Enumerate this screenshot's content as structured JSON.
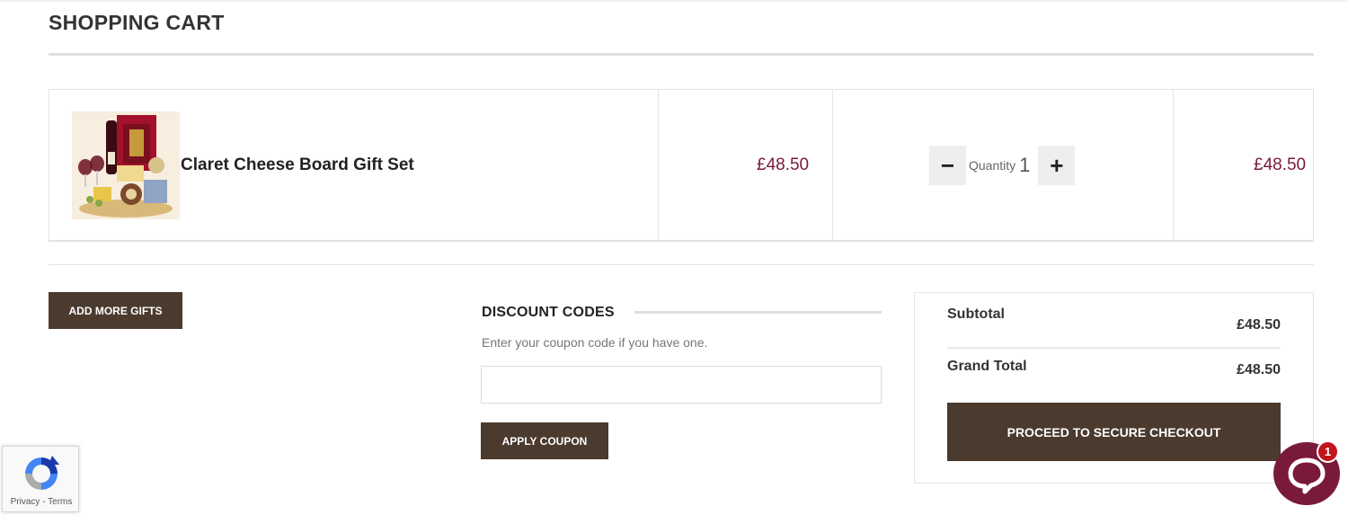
{
  "header": {
    "title": "SHOPPING CART"
  },
  "cart": {
    "items": [
      {
        "name": "Claret Cheese Board Gift Set",
        "image_alt": "product-photo",
        "unit_price": "£48.50",
        "quantity_label": "Quantity",
        "quantity": "1",
        "decrement_symbol": "−",
        "increment_symbol": "+",
        "line_total": "£48.50"
      }
    ]
  },
  "actions": {
    "add_more_gifts": "ADD MORE GIFTS"
  },
  "discount": {
    "title": "DISCOUNT CODES",
    "hint": "Enter your coupon code if you have one.",
    "input_value": "",
    "input_placeholder": "",
    "apply_label": "APPLY COUPON"
  },
  "totals": {
    "subtotal_label": "Subtotal",
    "subtotal_value": "£48.50",
    "grand_total_label": "Grand Total",
    "grand_total_value": "£48.50",
    "checkout_label": "PROCEED TO SECURE CHECKOUT"
  },
  "recaptcha": {
    "links": "Privacy - Terms"
  },
  "chat": {
    "badge_count": "1"
  },
  "colors": {
    "brand_dark": "#4b3a2e",
    "price": "#7a1a3a",
    "chat": "#7a1a3a",
    "badge": "#c0151c"
  },
  "icons": [
    "minus-icon",
    "plus-icon",
    "recaptcha-logo-icon",
    "chat-icon"
  ]
}
